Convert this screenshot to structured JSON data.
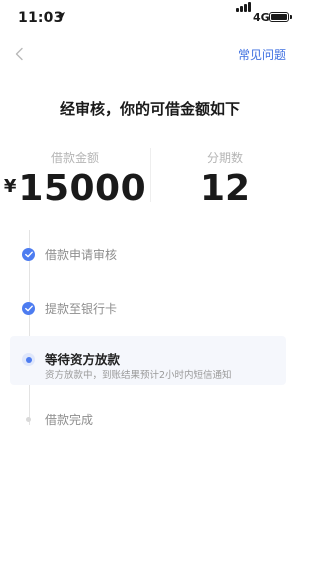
{
  "status_bar": {
    "time": "11:03",
    "network": "4G"
  },
  "nav": {
    "back_icon": "chevron-left-icon",
    "faq_label": "常见问题"
  },
  "headline": "经审核，你的可借金额如下",
  "summary": {
    "amount_label": "借款金额",
    "currency": "¥",
    "amount_value": "15000",
    "term_label": "分期数",
    "term_value": "12"
  },
  "steps": [
    {
      "title": "借款申请审核",
      "state": "done"
    },
    {
      "title": "提款至银行卡",
      "state": "done"
    },
    {
      "title": "等待资方放款",
      "state": "active",
      "description": "资方放款中，到账结果预计2小时内短信通知"
    },
    {
      "title": "借款完成",
      "state": "pending"
    }
  ],
  "colors": {
    "accent": "#4d7cf0",
    "link": "#3e6fe0",
    "muted_text": "#8e8e8e",
    "highlight_bg": "#f5f7fc"
  }
}
